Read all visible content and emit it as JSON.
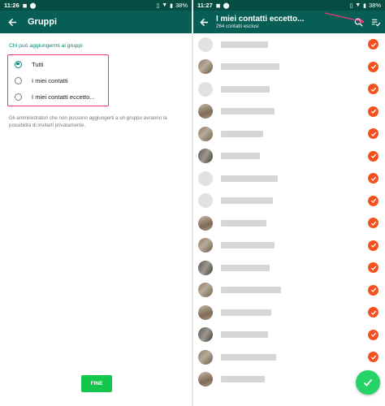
{
  "left": {
    "status_time": "11:26",
    "battery": "38%",
    "title": "Gruppi",
    "section_label": "Chi può aggiungermi ai gruppi",
    "options": [
      {
        "label": "Tutti",
        "selected": true
      },
      {
        "label": "I miei contatti",
        "selected": false
      },
      {
        "label": "I miei contatti eccetto...",
        "selected": false
      }
    ],
    "info": "Gli amministratori che non possono aggiungerti a un gruppo avranno la possibilità di invitarti privatamente.",
    "done_button": "FINE"
  },
  "right": {
    "status_time": "11:27",
    "battery": "38%",
    "title": "I miei contatti eccetto...",
    "subtitle": "264 contatti esclusi",
    "icons": [
      "back-arrow-icon",
      "search-icon",
      "select-all-icon"
    ]
  },
  "colors": {
    "appbar": "#075e54",
    "statusbar": "#064e44",
    "accent_teal": "#00897b",
    "highlight_box": "#e9367a",
    "done_green": "#14c64b",
    "check_orange": "#f4511e",
    "fab_green": "#25d366"
  }
}
